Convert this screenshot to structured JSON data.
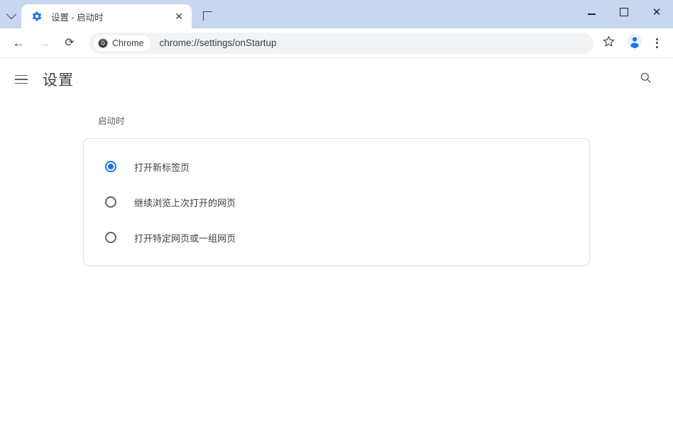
{
  "window": {
    "tab_search_icon": "chevron-down-icon",
    "minimize_label": "–",
    "maximize_label": "□",
    "close_label": "✕"
  },
  "tabstrip": {
    "tab": {
      "favicon": "gear-icon",
      "title": "设置 - 启动时",
      "close_label": "✕"
    },
    "new_tab_label": "+"
  },
  "toolbar": {
    "back_label": "←",
    "forward_label": "→",
    "reload_label": "⟳",
    "chrome_chip_label": "Chrome",
    "chrome_chip_icon": "chrome-logo-icon",
    "url": "chrome://settings/onStartup",
    "star_icon": "star-icon",
    "avatar_icon": "profile-avatar-icon",
    "menu_icon": "three-dot-menu-icon"
  },
  "settings": {
    "menu_icon": "hamburger-icon",
    "title": "设置",
    "search_icon": "search-icon",
    "section_heading": "启动时",
    "options": [
      {
        "label": "打开新标签页",
        "selected": true
      },
      {
        "label": "继续浏览上次打开的网页",
        "selected": false
      },
      {
        "label": "打开特定网页或一组网页",
        "selected": false
      }
    ]
  },
  "colors": {
    "accent": "#1a73e8",
    "tabstrip_bg": "#c8d6ef",
    "omnibox_bg": "#f1f3f4",
    "text": "#3c4043",
    "muted_text": "#5f6368"
  }
}
